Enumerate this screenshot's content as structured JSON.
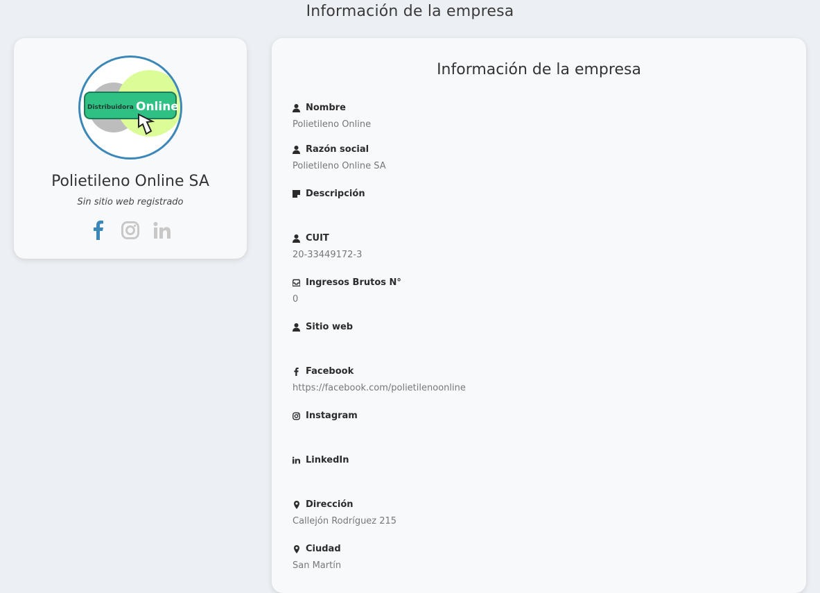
{
  "page": {
    "title": "Información de la empresa"
  },
  "profile": {
    "name": "Polietileno Online SA",
    "website_text": "Sin sitio web registrado",
    "logo_text_left": "Distribuidora",
    "logo_text_right": "Online",
    "colors": {
      "facebook": "#3a87b8",
      "instagram": "#c8c8c8",
      "linkedin": "#c8c8c8",
      "logo_border": "#3a87b8"
    }
  },
  "info": {
    "title": "Información de la empresa",
    "fields": [
      {
        "label": "Nombre",
        "value": "Polietileno Online",
        "icon": "user-icon"
      },
      {
        "label": "Razón social",
        "value": "Polietileno Online SA",
        "icon": "user-icon"
      },
      {
        "label": "Descripción",
        "value": "",
        "icon": "note-icon"
      },
      {
        "label": "CUIT",
        "value": "20-33449172-3",
        "icon": "user-icon"
      },
      {
        "label": "Ingresos Brutos N°",
        "value": "0",
        "icon": "inbox-icon"
      },
      {
        "label": "Sitio web",
        "value": "",
        "icon": "user-icon"
      },
      {
        "label": "Facebook",
        "value": "https://facebook.com/polietilenoonline",
        "icon": "facebook-icon"
      },
      {
        "label": "Instagram",
        "value": "",
        "icon": "instagram-icon"
      },
      {
        "label": "LinkedIn",
        "value": "",
        "icon": "linkedin-icon"
      },
      {
        "label": "Dirección",
        "value": "Callejón Rodríguez 215",
        "icon": "map-marker-icon"
      },
      {
        "label": "Ciudad",
        "value": "San Martín",
        "icon": "map-marker-icon"
      }
    ]
  }
}
